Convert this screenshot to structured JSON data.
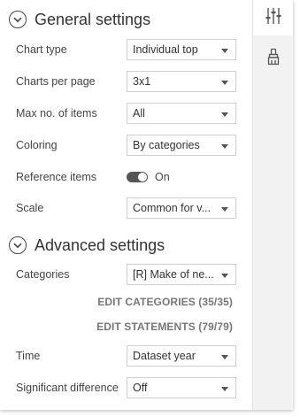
{
  "general": {
    "title": "General settings",
    "chart_type": {
      "label": "Chart type",
      "value": "Individual top"
    },
    "charts_per_page": {
      "label": "Charts per page",
      "value": "3x1"
    },
    "max_items": {
      "label": "Max no. of items",
      "value": "All"
    },
    "coloring": {
      "label": "Coloring",
      "value": "By categories"
    },
    "reference_items": {
      "label": "Reference items",
      "state": "On"
    },
    "scale": {
      "label": "Scale",
      "value": "Common for v..."
    }
  },
  "advanced": {
    "title": "Advanced settings",
    "categories": {
      "label": "Categories",
      "value": "[R] Make of ne..."
    },
    "edit_categories": "EDIT CATEGORIES (35/35)",
    "edit_statements": "EDIT STATEMENTS (79/79)",
    "time": {
      "label": "Time",
      "value": "Dataset year"
    },
    "significant_difference": {
      "label": "Significant difference",
      "value": "Off"
    }
  },
  "sidebar": {
    "tabs": [
      {
        "icon": "sliders-icon",
        "active": true
      },
      {
        "icon": "brush-icon",
        "active": false
      }
    ]
  },
  "colors": {
    "toggle_on": "#555555",
    "sidebar_bg": "#f2f2f2",
    "link_text": "#777777"
  }
}
